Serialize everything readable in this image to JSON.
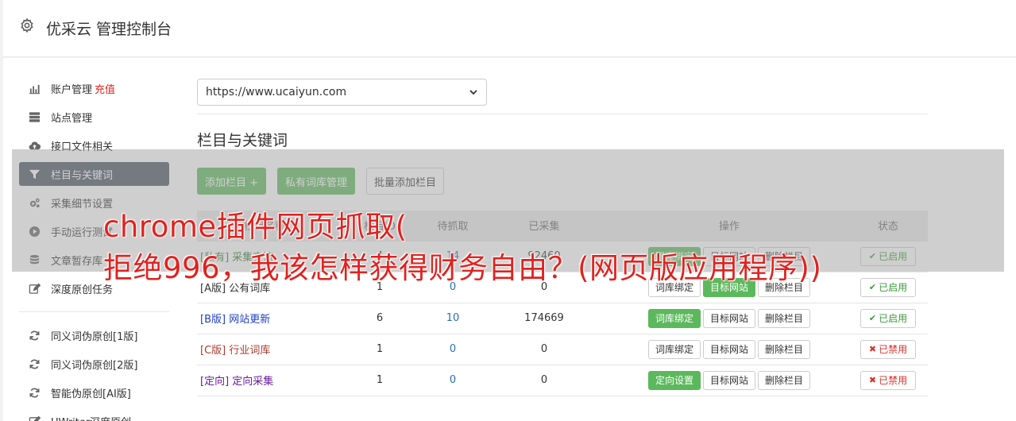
{
  "header": {
    "title": "优采云 管理控制台"
  },
  "sidebar": {
    "group1": [
      {
        "label": "账户管理",
        "extra": "充值",
        "icon": "bar-chart-icon"
      },
      {
        "label": "站点管理",
        "icon": "server-icon"
      },
      {
        "label": "接口文件相关",
        "icon": "cloud-upload-icon"
      },
      {
        "label": "栏目与关键词",
        "icon": "filter-icon",
        "active": true
      },
      {
        "label": "采集细节设置",
        "icon": "cogs-icon"
      },
      {
        "label": "手动运行测试",
        "icon": "play-circle-icon"
      },
      {
        "label": "文章暂存库",
        "icon": "database-icon"
      },
      {
        "label": "深度原创任务",
        "icon": "edit-icon"
      }
    ],
    "group2": [
      {
        "label": "同义词伪原创[1版]",
        "icon": "refresh-icon"
      },
      {
        "label": "同义词伪原创[2版]",
        "icon": "refresh-icon"
      },
      {
        "label": "智能伪原创[AI版]",
        "icon": "refresh-icon"
      },
      {
        "label": "UWriter深度原创",
        "icon": "edit-icon"
      }
    ]
  },
  "main": {
    "site_select": "https://www.ucaiyun.com",
    "section_title": "栏目与关键词",
    "buttons": {
      "add_column": "添加栏目 +",
      "private_lib": "私有词库管理",
      "batch_add": "批量添加栏目"
    },
    "table": {
      "headers": [
        "栏目名称",
        "栏目ID",
        "待抓取",
        "已采集",
        "操作",
        "状态"
      ],
      "rows": [
        {
          "tag": "[私有]",
          "name": "采集交流",
          "id": "4",
          "pending": "14",
          "collected": "92460",
          "op1": "词库绑定",
          "op2": "目标网站",
          "op3": "删除栏目",
          "status": "已启用",
          "on": true
        },
        {
          "tag": "[A版]",
          "name": "公有词库",
          "id": "1",
          "pending": "0",
          "collected": "0",
          "op1": "词库绑定",
          "op2": "目标网站",
          "op3": "删除栏目",
          "status": "已启用",
          "on": true
        },
        {
          "tag": "[B版]",
          "name": "网站更新",
          "id": "6",
          "pending": "10",
          "collected": "174669",
          "op1": "词库绑定",
          "op2": "目标网站",
          "op3": "删除栏目",
          "status": "已启用",
          "on": true
        },
        {
          "tag": "[C版]",
          "name": "行业词库",
          "id": "1",
          "pending": "0",
          "collected": "0",
          "op1": "词库绑定",
          "op2": "目标网站",
          "op3": "删除栏目",
          "status": "已禁用",
          "on": false
        },
        {
          "tag": "[定向]",
          "name": "定向采集",
          "id": "1",
          "pending": "0",
          "collected": "0",
          "op1": "定向设置",
          "op2": "目标网站",
          "op3": "删除栏目",
          "status": "已禁用",
          "on": false
        }
      ]
    }
  },
  "overlay": {
    "line1": "chrome插件网页抓取(",
    "line2": "拒绝996，我该怎样获得财务自由？(网页版应用程序))"
  }
}
